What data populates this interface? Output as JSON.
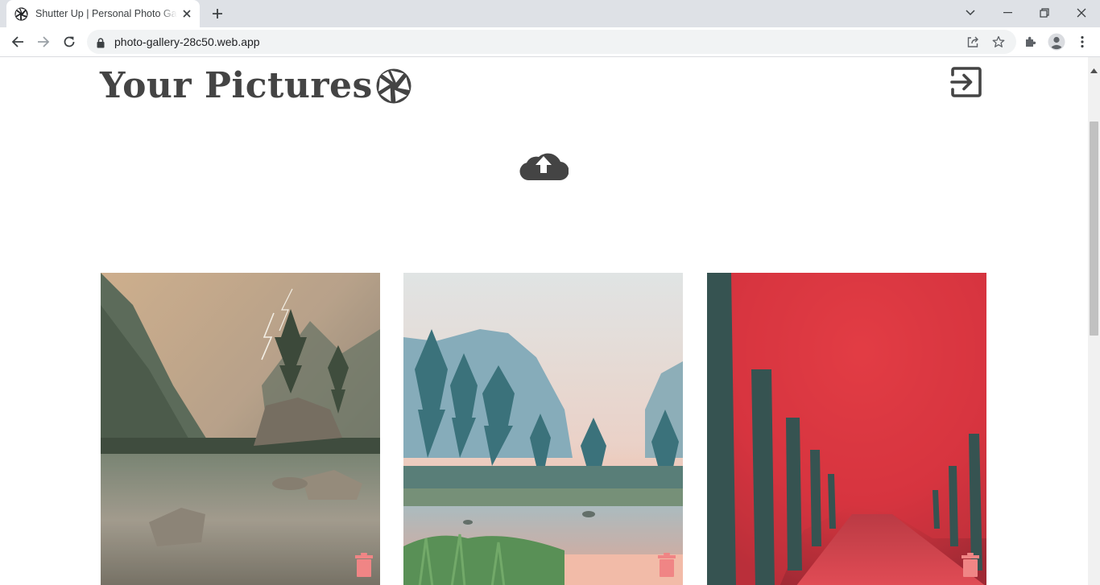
{
  "browser": {
    "tab_title": "Shutter Up | Personal Photo Gallery",
    "url": "photo-gallery-28c50.web.app"
  },
  "page": {
    "title": "Your Pictures"
  },
  "gallery": {
    "photos": [
      {
        "subject": "lake with rocky island and lightning storm"
      },
      {
        "subject": "misty mountain valley with river and pines"
      },
      {
        "subject": "avenue of red autumn trees"
      }
    ]
  },
  "colors": {
    "text_dark": "#444444",
    "delete_accent": "#f08585",
    "chrome_bg": "#dee1e6"
  },
  "icons": [
    "aperture-icon",
    "logout-icon",
    "upload-cloud-icon",
    "trash-icon"
  ]
}
